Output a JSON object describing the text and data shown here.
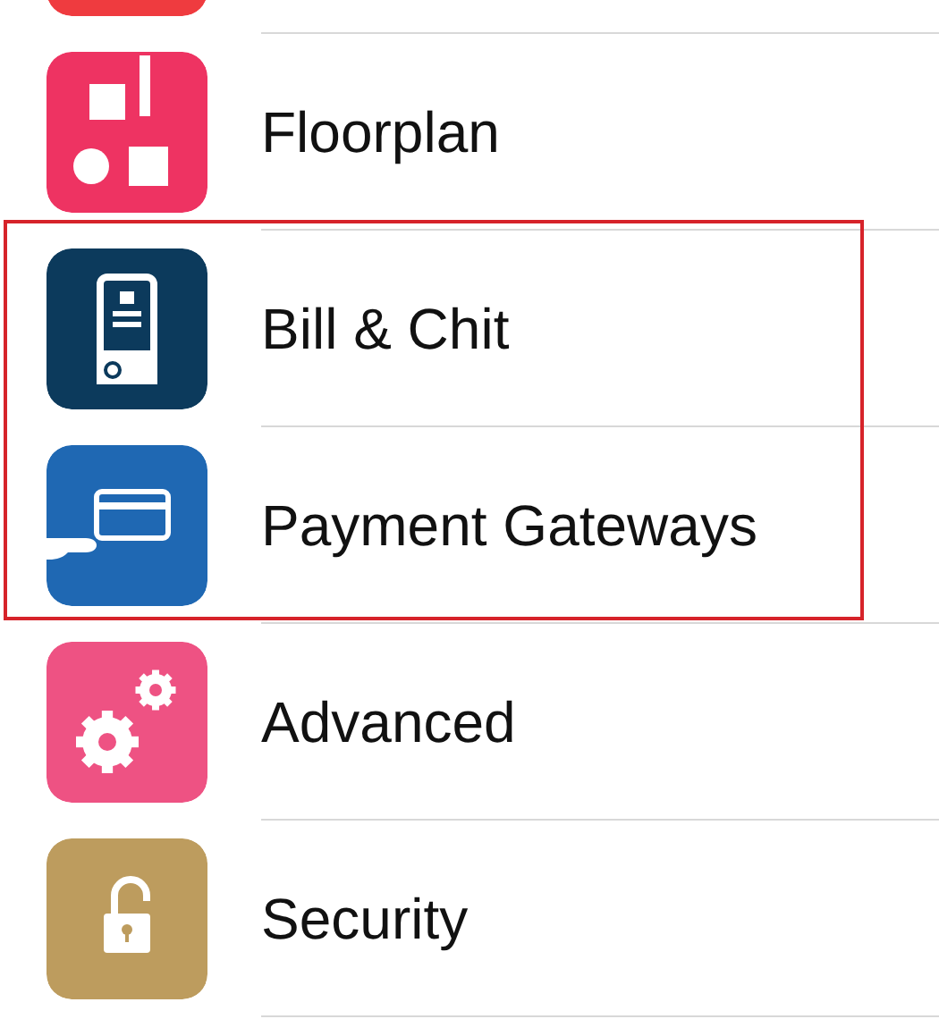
{
  "items": [
    {
      "kind": "partial",
      "color": "#ef3b3f",
      "highlighted": false
    },
    {
      "kind": "floorplan",
      "label": "Floorplan",
      "color": "#ee3362",
      "highlighted": false
    },
    {
      "kind": "bill",
      "label": "Bill & Chit",
      "color": "#0c3a5c",
      "highlighted": true
    },
    {
      "kind": "payment",
      "label": "Payment Gateways",
      "color": "#1f68b3",
      "highlighted": true
    },
    {
      "kind": "advanced",
      "label": "Advanced",
      "color": "#ee5283",
      "highlighted": false
    },
    {
      "kind": "security",
      "label": "Security",
      "color": "#bd9c5e",
      "highlighted": false
    }
  ]
}
